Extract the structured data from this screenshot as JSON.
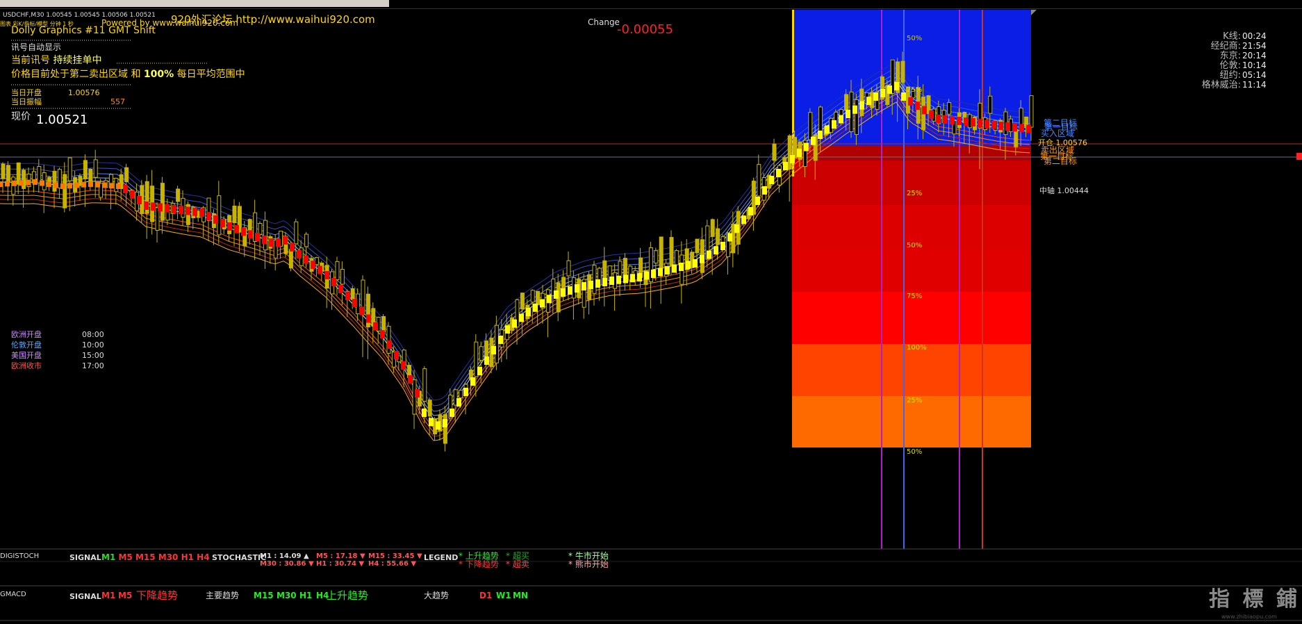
{
  "window": {
    "symbol_line": "USDCHF,M30 1.00545 1.00545 1.00506 1.00521",
    "site_text": "920外汇论坛 http://www.waihui920.com",
    "powered_by": "Powered by www.waihui920.com",
    "indicator_line": "图表 彩K/指标/模型 分钟 1 秒",
    "watermark": "指 標 鋪",
    "watermark_url": "www.zhibiaopu.com"
  },
  "info_panel": {
    "title": "Dolly Graphics #11 GMT Shift",
    "signal_auto": "讯号自动显示",
    "current_signal_prefix": "当前讯号",
    "current_signal": "持续挂单中",
    "zone_prefix": "价格目前处于第二卖出区域 和",
    "zone_pct": "100%",
    "zone_suffix": "每日平均范围中",
    "open_label": "当日开盘",
    "open_value": "1.00576",
    "range_label": "当日振幅",
    "range_value": "557",
    "price_label": "现价",
    "price_value": "1.00521"
  },
  "change": {
    "label": "Change",
    "value": "-0.00055"
  },
  "clock": {
    "labels": [
      "K线:",
      "经纪商:",
      "东京:",
      "伦敦:",
      "纽约:",
      "格林威治:"
    ],
    "values": [
      "00:24",
      "21:54",
      "20:14",
      "10:14",
      "05:14",
      "11:14"
    ]
  },
  "sessions": [
    {
      "label": "欧洲开盘",
      "time": "08:00",
      "color": "#cc88ff"
    },
    {
      "label": "伦敦开盘",
      "time": "10:00",
      "color": "#55aaff"
    },
    {
      "label": "美国开盘",
      "time": "15:00",
      "color": "#cc88ff"
    },
    {
      "label": "欧洲收市",
      "time": "17:00",
      "color": "#ff5555"
    }
  ],
  "right_labels": {
    "second_target": "第二目标",
    "first_target": "第一目标",
    "buy_zone": "买入区域",
    "open": "开仓 1.00576",
    "sell_zone": "卖出区域",
    "first_target2": "第一目标",
    "second_target2": "第二目标",
    "pivot": "中轴 1.00444"
  },
  "zone_pcts": [
    "50%",
    "25%",
    "25%",
    "50%",
    "75%",
    "100%",
    "25%",
    "50%"
  ],
  "colors": {
    "blue_zone": "#0a1ee6",
    "candle": "#c8b400",
    "yellow": "#ffff00",
    "red": "#ff0000"
  },
  "digistoch": {
    "name": "DIGISTOCH",
    "signal_label": "SIGNAL",
    "tfs": [
      {
        "t": "M1",
        "c": "#22dd22"
      },
      {
        "t": "M5",
        "c": "#ff3333"
      },
      {
        "t": "M15",
        "c": "#ff3333"
      },
      {
        "t": "M30",
        "c": "#ff3333"
      },
      {
        "t": "H1",
        "c": "#ff3333"
      },
      {
        "t": "H4",
        "c": "#ff3333"
      }
    ],
    "stoch_label": "STOCHASTIC",
    "stoch_vals": [
      "M1 : 14.09",
      "M5 : 17.18",
      "M15 : 33.45",
      "M30 : 30.86",
      "H1 : 30.74",
      "H4 : 55.66"
    ],
    "legend_label": "LEGEND",
    "legend": [
      "上升趋势",
      "超买",
      "牛市开始",
      "下降趋势",
      "超卖",
      "熊市开始"
    ]
  },
  "gmacd": {
    "name": "GMACD",
    "signal_label": "SIGNAL",
    "down_tfs": [
      "M1",
      "M5"
    ],
    "down_text": "下降趋势",
    "main_label": "主要趋势",
    "up_tfs": [
      "M15",
      "M30",
      "H1",
      "H4"
    ],
    "up_text": "上升趋势",
    "big_label": "大趋势",
    "big_tfs": [
      "D1",
      "W1",
      "MN"
    ]
  }
}
